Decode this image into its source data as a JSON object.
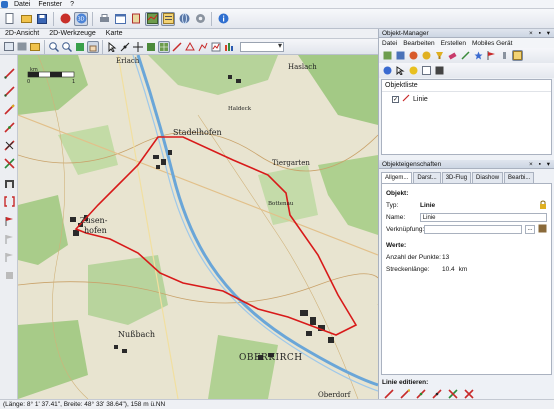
{
  "menubar": {
    "items": [
      "Datei",
      "Fenster",
      "?"
    ]
  },
  "left_tabs": [
    "2D-Ansicht",
    "2D-Werkzeuge",
    "Karte"
  ],
  "map": {
    "scale_label": "km",
    "scale_ticks": [
      "0",
      "1"
    ],
    "place_names": [
      "Erlach",
      "Haslach",
      "Stadelhofen",
      "Tiergarten",
      "Zusen-",
      "hofen",
      "Nußbach",
      "OBERKIRCH",
      "Oberdorf",
      "Haldeck",
      "Bottenau"
    ],
    "route_color": "#d81a1a"
  },
  "object_manager": {
    "title": "Objekt-Manager",
    "menu": [
      "Datei",
      "Bearbeiten",
      "Erstellen",
      "Mobiles Gerät"
    ],
    "list_header": "Objektliste",
    "items": [
      {
        "label": "Linie",
        "checked": true
      }
    ]
  },
  "properties": {
    "title": "Objekteigenschaften",
    "tabs": [
      "Allgem...",
      "Darst...",
      "3D-Flug",
      "Diashow",
      "Bearbi..."
    ],
    "object_section": "Objekt:",
    "type_label": "Typ:",
    "type_value": "Linie",
    "name_label": "Name:",
    "name_value": "Linie",
    "link_label": "Verknüpfung:",
    "link_button": "...",
    "values_section": "Werte:",
    "points_label": "Anzahl der Punkte:",
    "points_value": "13",
    "length_label": "Streckenlänge:",
    "length_value": "10.4",
    "length_unit": "km"
  },
  "linie_edit": {
    "title": "Linie editieren:"
  },
  "status": {
    "text": "(Länge: 8° 1' 37.41\", Breite: 48° 33' 38.64\"), 158 m ü.NN"
  },
  "panel_controls": "× ▪ ▾"
}
